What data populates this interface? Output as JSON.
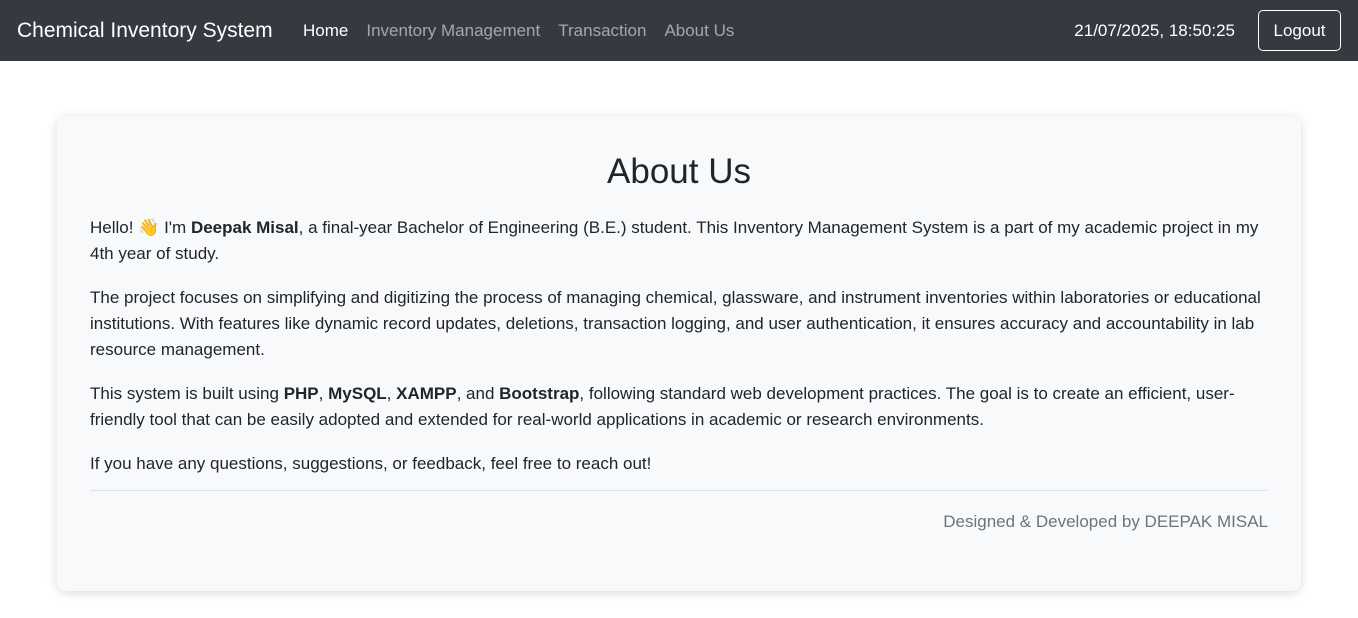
{
  "navbar": {
    "brand": "Chemical Inventory System",
    "links": [
      {
        "label": "Home",
        "active": true
      },
      {
        "label": "Inventory Management",
        "active": false
      },
      {
        "label": "Transaction",
        "active": false
      },
      {
        "label": "About Us",
        "active": false
      }
    ],
    "datetime": "21/07/2025, 18:50:25",
    "logout_label": "Logout"
  },
  "about": {
    "title": "About Us",
    "p1": {
      "pre": "Hello! ",
      "emoji": "👋",
      "mid": " I'm ",
      "name": "Deepak Misal",
      "post": ", a final-year Bachelor of Engineering (B.E.) student. This Inventory Management System is a part of my academic project in my 4th year of study."
    },
    "p2": "The project focuses on simplifying and digitizing the process of managing chemical, glassware, and instrument inventories within laboratories or educational institutions. With features like dynamic record updates, deletions, transaction logging, and user authentication, it ensures accuracy and accountability in lab resource management.",
    "p3": {
      "pre": "This system is built using ",
      "tech1": "PHP",
      "sep1": ", ",
      "tech2": "MySQL",
      "sep2": ", ",
      "tech3": "XAMPP",
      "sep3": ", and ",
      "tech4": "Bootstrap",
      "post": ", following standard web development practices. The goal is to create an efficient, user-friendly tool that can be easily adopted and extended for real-world applications in academic or research environments."
    },
    "p4": "If you have any questions, suggestions, or feedback, feel free to reach out!",
    "credit": "Designed & Developed by DEEPAK MISAL"
  },
  "colors": {
    "navbar_bg": "#343a40",
    "card_bg": "#f8f9fa",
    "muted_text": "#6c757d"
  }
}
